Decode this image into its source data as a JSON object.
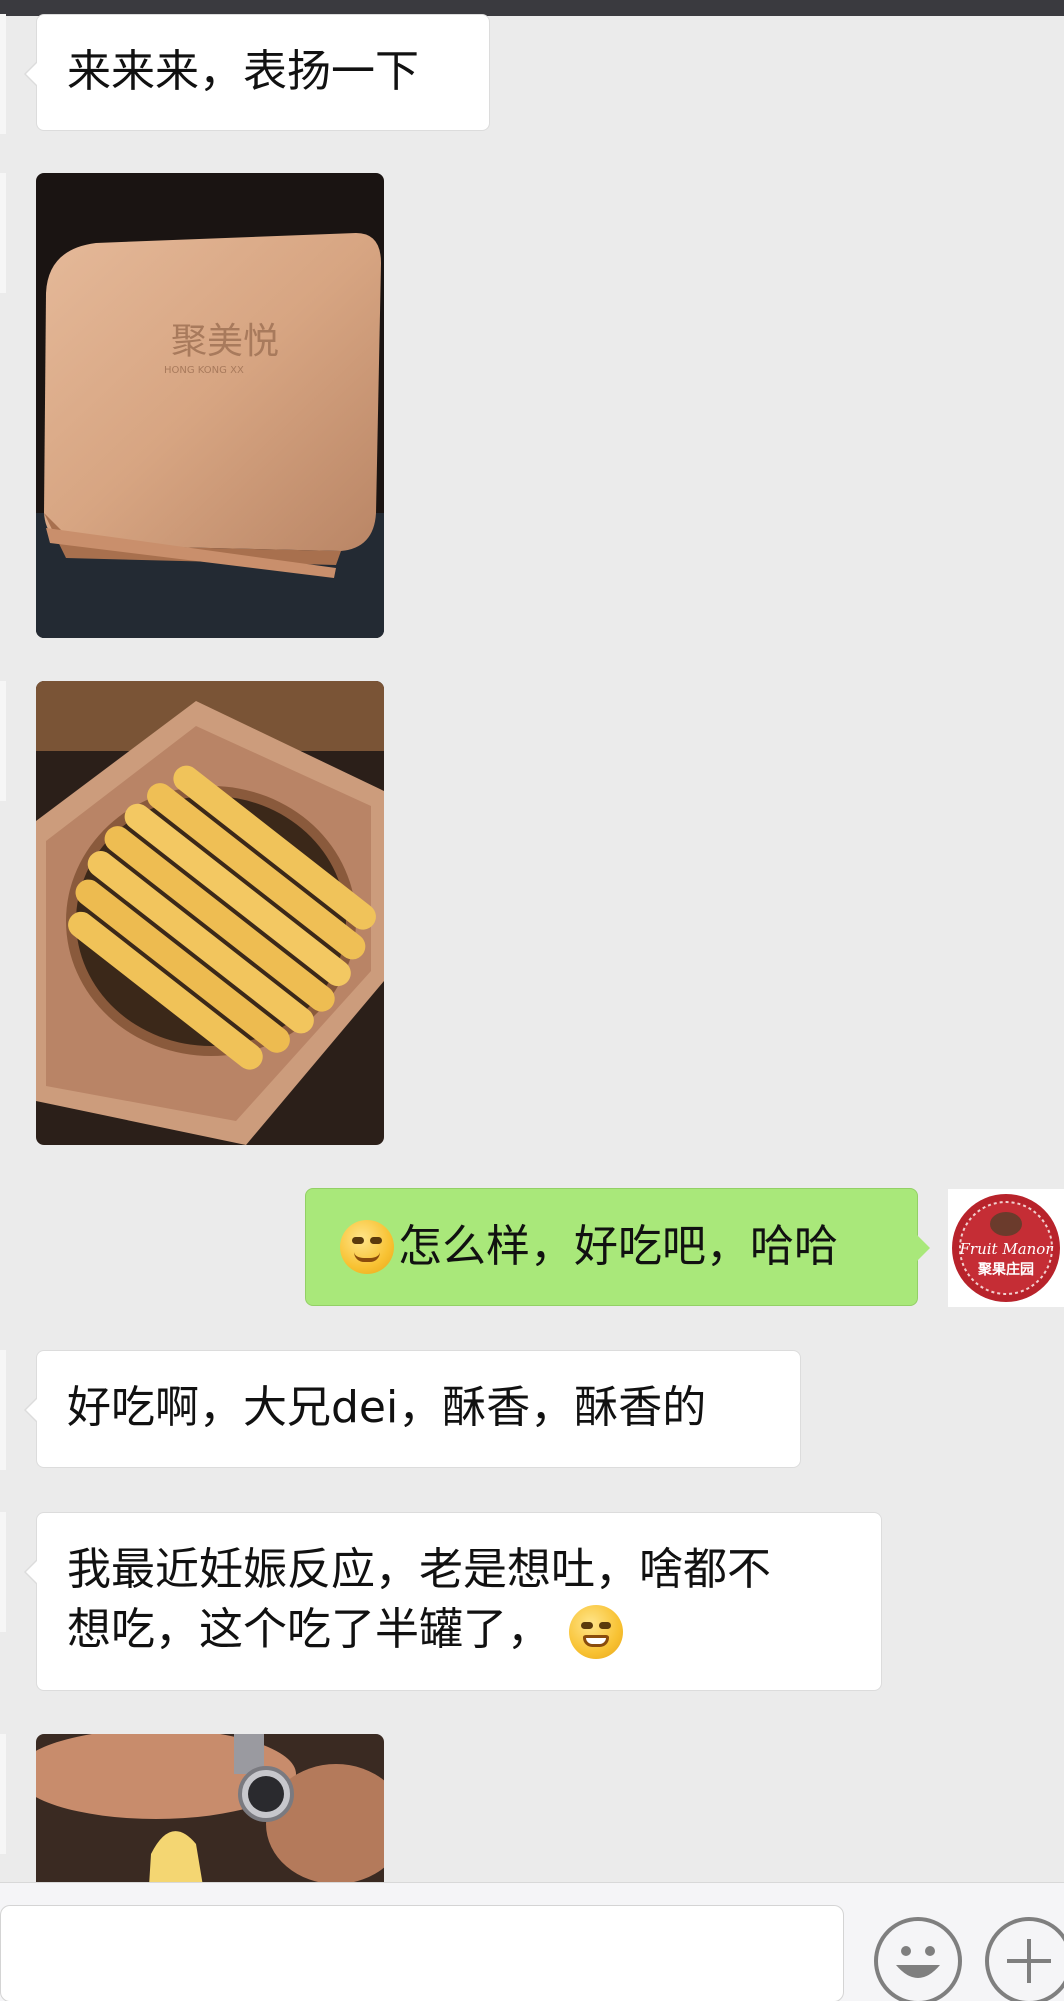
{
  "messages": [
    {
      "type": "text",
      "direction": "in",
      "text": "来来来，表扬一下"
    },
    {
      "type": "image",
      "direction": "in",
      "alt": "gold tin box with embossed logo",
      "logo_text": "聚美悦",
      "logo_subtext": "HONG KONG XX"
    },
    {
      "type": "image",
      "direction": "in",
      "alt": "open tin with rolled egg biscuits"
    },
    {
      "type": "text",
      "direction": "out",
      "emoji_before": "smirk-emoji",
      "text": "怎么样，好吃吧，哈哈"
    },
    {
      "type": "text",
      "direction": "in",
      "text": "好吃啊，大兄dei，酥香，酥香的"
    },
    {
      "type": "text",
      "direction": "in",
      "line1": "我最近妊娠反应，老是想吐，啥都不",
      "line2": "想吃，这个吃了半罐了，",
      "emoji_after": "grin-emoji"
    },
    {
      "type": "image",
      "direction": "in",
      "alt": "hand holding a biscuit with wristwatch"
    }
  ],
  "avatar": {
    "line1": "Fruit Manor",
    "line2": "聚果庄园",
    "colors": {
      "ring": "#b8232b",
      "text": "#ffffff"
    }
  },
  "input": {
    "placeholder": "",
    "emoji_button": "smiley-face-icon",
    "plus_button": "plus-icon"
  },
  "colors": {
    "background": "#ebebeb",
    "outgoing_bubble": "#a9e87a",
    "incoming_bubble": "#ffffff"
  }
}
